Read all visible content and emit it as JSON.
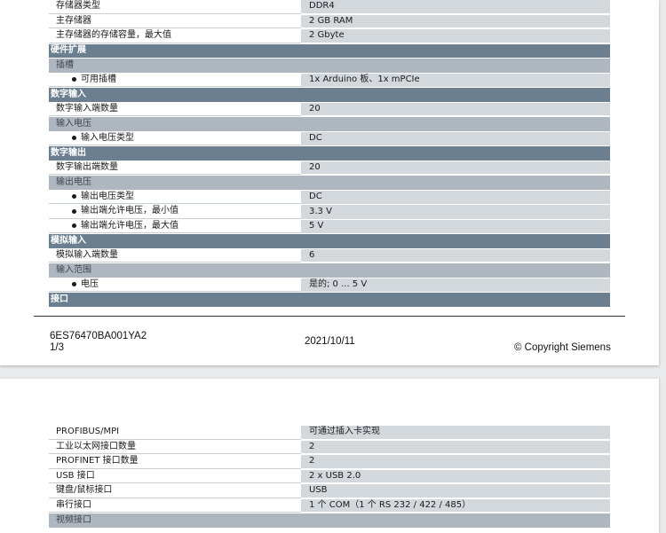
{
  "page1": {
    "rows": [
      {
        "kind": "data",
        "label": "存储器类型",
        "value": "DDR4"
      },
      {
        "kind": "data",
        "label": "主存储器",
        "value": "2 GB RAM"
      },
      {
        "kind": "data",
        "label": "主存储器的存储容量，最大值",
        "value": "2 Gbyte"
      },
      {
        "kind": "section",
        "label": "硬件扩展"
      },
      {
        "kind": "subhead",
        "label": "插槽"
      },
      {
        "kind": "bullet",
        "label": "可用插槽",
        "value": "1x Arduino 板、1x mPCIe"
      },
      {
        "kind": "section",
        "label": "数字输入"
      },
      {
        "kind": "data",
        "label": "数字输入端数量",
        "value": "20"
      },
      {
        "kind": "subhead",
        "label": "输入电压"
      },
      {
        "kind": "bullet",
        "label": "输入电压类型",
        "value": "DC"
      },
      {
        "kind": "section",
        "label": "数字输出"
      },
      {
        "kind": "data",
        "label": "数字输出端数量",
        "value": "20"
      },
      {
        "kind": "subhead",
        "label": "输出电压"
      },
      {
        "kind": "bullet",
        "label": "输出电压类型",
        "value": "DC"
      },
      {
        "kind": "bullet",
        "label": "输出端允许电压，最小值",
        "value": "3.3 V"
      },
      {
        "kind": "bullet",
        "label": "输出端允许电压，最大值",
        "value": "5 V"
      },
      {
        "kind": "section",
        "label": "模拟输入"
      },
      {
        "kind": "data",
        "label": "模拟输入端数量",
        "value": "6"
      },
      {
        "kind": "subhead",
        "label": "输入范围"
      },
      {
        "kind": "bullet",
        "label": "电压",
        "value": "是的; 0 ... 5 V"
      },
      {
        "kind": "section",
        "label": "接口"
      }
    ],
    "footer": {
      "order_number": "6ES76470BA001YA2",
      "page": "1/3",
      "date": "2021/10/11",
      "copyright": "© Copyright Siemens"
    }
  },
  "page2": {
    "rows": [
      {
        "kind": "data",
        "label": "PROFIBUS/MPI",
        "value": "可通过插入卡实现"
      },
      {
        "kind": "data",
        "label": "工业以太网接口数量",
        "value": "2"
      },
      {
        "kind": "data",
        "label": "PROFINET 接口数量",
        "value": "2"
      },
      {
        "kind": "data",
        "label": "USB 接口",
        "value": "2 x USB 2.0"
      },
      {
        "kind": "data",
        "label": "键盘/鼠标接口",
        "value": "USB"
      },
      {
        "kind": "data",
        "label": "串行接口",
        "value": "1 个 COM（1 个 RS 232 / 422 / 485）"
      },
      {
        "kind": "subhead",
        "label": "视频接口"
      }
    ]
  },
  "colors": {
    "section_bg": "#6b7f91",
    "subhead_bg": "#aeb6bf",
    "value_bg": "#d3d8dd"
  }
}
